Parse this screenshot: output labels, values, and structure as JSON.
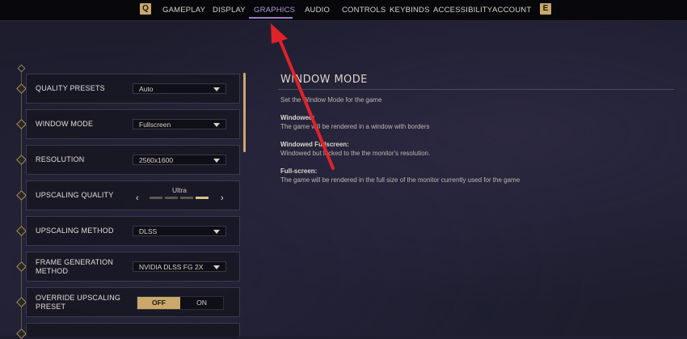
{
  "topbar": {
    "left_key": "Q",
    "right_key": "E",
    "tabs": [
      {
        "label": "GAMEPLAY"
      },
      {
        "label": "DISPLAY"
      },
      {
        "label": "GRAPHICS"
      },
      {
        "label": "AUDIO"
      },
      {
        "label": "CONTROLS"
      },
      {
        "label": "KEYBINDS"
      },
      {
        "label": "ACCESSIBILITY"
      },
      {
        "label": "ACCOUNT"
      }
    ],
    "active_tab": "GRAPHICS"
  },
  "settings": {
    "quality_presets": {
      "label": "QUALITY PRESETS",
      "value": "Auto"
    },
    "window_mode": {
      "label": "WINDOW MODE",
      "value": "Fullscreen"
    },
    "resolution": {
      "label": "RESOLUTION",
      "value": "2560x1600"
    },
    "upscaling_quality": {
      "label": "UPSCALING QUALITY",
      "value": "Ultra",
      "level": 4,
      "levels": 4
    },
    "upscaling_method": {
      "label": "UPSCALING METHOD",
      "value": "DLSS"
    },
    "frame_generation": {
      "label_line1": "FRAME GENERATION",
      "label_line2": "METHOD",
      "value": "NVIDIA DLSS FG 2X"
    },
    "override_upscaling": {
      "label_line1": "OVERRIDE UPSCALING",
      "label_line2": "PRESET",
      "off_label": "OFF",
      "on_label": "ON",
      "state": "OFF"
    }
  },
  "info_panel": {
    "title": "WINDOW MODE",
    "description": "Set the Window Mode for the game",
    "options": [
      {
        "name": "Windowed:",
        "desc": "The game will be rendered in a window with borders"
      },
      {
        "name": "Windowed Fullscreen:",
        "desc": "Windowed but locked to the the monitor's resolution."
      },
      {
        "name": "Full-screen:",
        "desc": "The game will be rendered in the full size of the monitor currently used for the game"
      }
    ]
  },
  "colors": {
    "accent_gold": "#c9a86a",
    "active_tab": "#b59ad6",
    "annotation_arrow": "#e0222b"
  }
}
